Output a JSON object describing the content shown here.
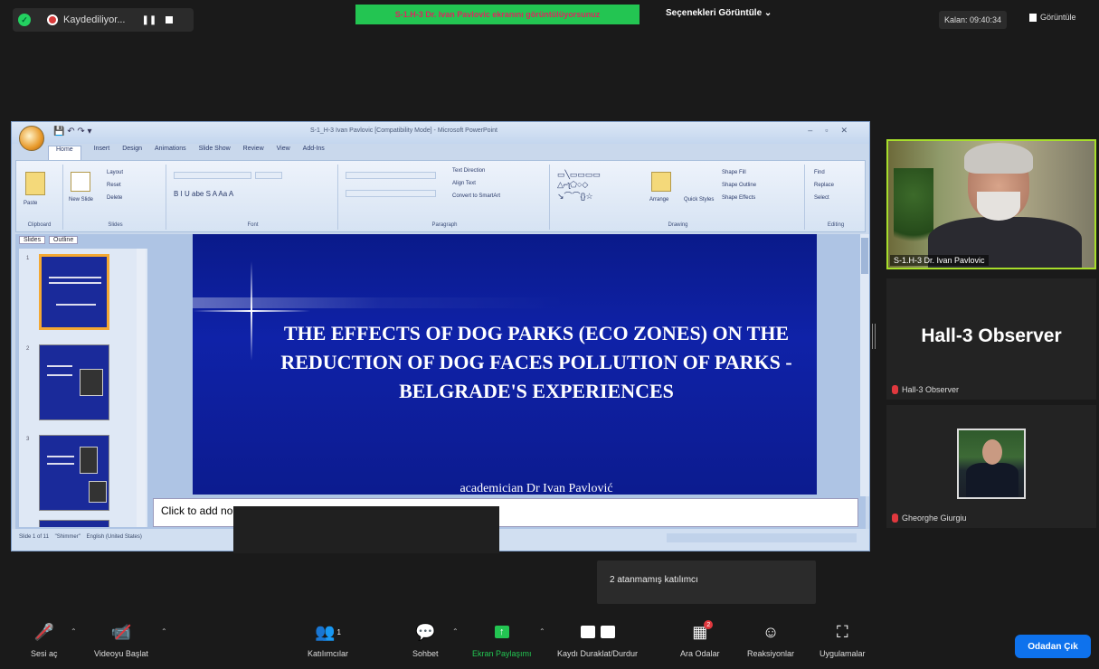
{
  "topbar": {
    "recording_label": "Kaydediliyor...",
    "share_banner": "S-1.H-3 Dr. Ivan Pavlovic ekranını görüntülüyorsunuz",
    "view_options": "Seçenekleri Görüntüle ⌄",
    "clock": "Kalan: 09:40:34",
    "view_button": "Görüntüle"
  },
  "ppt": {
    "window_title": "S-1_H-3 Ivan Pavlovic [Compatibility Mode] - Microsoft PowerPoint",
    "tabs": [
      "Home",
      "Insert",
      "Design",
      "Animations",
      "Slide Show",
      "Review",
      "View",
      "Add-Ins"
    ],
    "ribbon_groups": [
      "Clipboard",
      "Slides",
      "Font",
      "Paragraph",
      "Drawing",
      "Editing"
    ],
    "ribbon_buttons": {
      "paste": "Paste",
      "new_slide": "New Slide",
      "layout": "Layout",
      "reset": "Reset",
      "delete": "Delete",
      "text_direction": "Text Direction",
      "align_text": "Align Text",
      "convert_smartart": "Convert to SmartArt",
      "arrange": "Arrange",
      "quick_styles": "Quick Styles",
      "shape_fill": "Shape Fill",
      "shape_outline": "Shape Outline",
      "shape_effects": "Shape Effects",
      "find": "Find",
      "replace": "Replace",
      "select": "Select"
    },
    "panel_tabs": [
      "Slides",
      "Outline"
    ],
    "slide_title": "THE EFFECTS OF DOG PARKS (ECO ZONES) ON THE REDUCTION OF DOG FACES POLLUTION OF PARKS - BELGRADE'S EXPERIENCES",
    "slide_subtitle": "academician Dr Ivan Pavlović",
    "notes_placeholder": "Click to add no",
    "status": {
      "slide_info": "Slide 1 of 11",
      "theme": "\"Shimmer\"",
      "language": "English (United States)"
    }
  },
  "participants": {
    "presenter_name": "S-1.H-3 Dr. Ivan Pavlovic",
    "observer_big": "Hall-3 Observer",
    "observer_label": "Hall-3 Observer",
    "third_name": "Gheorghe Giurgiu"
  },
  "popup": {
    "text": "2 atanmamış katılımcı"
  },
  "toolbar": {
    "mic": "Sesi aç",
    "video": "Videoyu Başlat",
    "participants": "Katılımcılar",
    "participants_count": "1",
    "chat": "Sohbet",
    "share": "Ekran Paylaşımı",
    "record": "Kaydı Duraklat/Durdur",
    "breakout": "Ara Odalar",
    "breakout_badge": "2",
    "reactions": "Reaksiyonlar",
    "apps": "Uygulamalar",
    "leave": "Odadan Çık"
  },
  "colors": {
    "zoom_green": "#23c552",
    "leave_blue": "#0e72ed",
    "slide_blue": "#0f22a8",
    "active_speaker_border": "#a7de2b",
    "mute_red": "#e0383e"
  }
}
